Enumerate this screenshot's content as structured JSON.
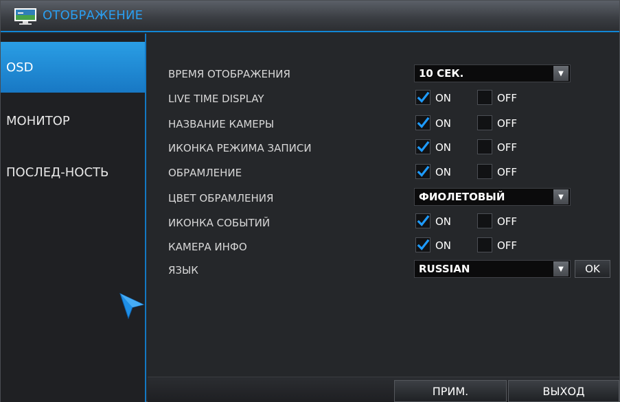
{
  "window": {
    "title": "ОТОБРАЖЕНИЕ"
  },
  "sidebar": {
    "items": [
      {
        "label": "OSD",
        "active": true
      },
      {
        "label": "МОНИТОР",
        "active": false
      },
      {
        "label": "ПОСЛЕД-НОСТЬ",
        "active": false
      }
    ]
  },
  "settings": {
    "display_time": {
      "label": "ВРЕМЯ ОТОБРАЖЕНИЯ",
      "value": "10 СЕК."
    },
    "live_time_display": {
      "label": "LIVE TIME DISPLAY",
      "on": "ON",
      "off": "OFF",
      "checked": "on"
    },
    "camera_name": {
      "label": "НАЗВАНИЕ КАМЕРЫ",
      "on": "ON",
      "off": "OFF",
      "checked": "on"
    },
    "record_mode_icon": {
      "label": "ИКОНКА РЕЖИМА ЗАПИСИ",
      "on": "ON",
      "off": "OFF",
      "checked": "on"
    },
    "border": {
      "label": "ОБРАМЛЕНИЕ",
      "on": "ON",
      "off": "OFF",
      "checked": "on"
    },
    "border_color": {
      "label": "ЦВЕТ ОБРАМЛЕНИЯ",
      "value": "ФИОЛЕТОВЫЙ"
    },
    "event_icon": {
      "label": "ИКОНКА СОБЫТИЙ",
      "on": "ON",
      "off": "OFF",
      "checked": "on"
    },
    "camera_info": {
      "label": "КАМЕРА ИНФО",
      "on": "ON",
      "off": "OFF",
      "checked": "on"
    },
    "language": {
      "label": "ЯЗЫК",
      "value": "RUSSIAN",
      "ok": "OK"
    }
  },
  "footer": {
    "apply": "ПРИМ.",
    "exit": "ВЫХОД"
  },
  "icons": {
    "title": "monitor-icon",
    "checkmark": "checkmark-icon",
    "dropdown": "dropdown-arrow-icon",
    "cursor": "mouse-cursor-icon"
  },
  "colors": {
    "accent": "#1a8fe0",
    "title_text": "#2a9ef0",
    "check": "#1e9bff"
  }
}
